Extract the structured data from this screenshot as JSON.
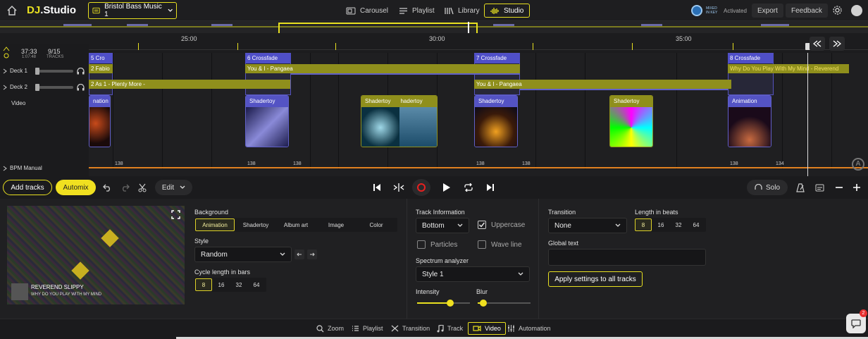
{
  "app": {
    "logo": "DJ.Studio",
    "project": "Bristol Bass Music 1"
  },
  "nav": {
    "carousel": "Carousel",
    "playlist": "Playlist",
    "library": "Library",
    "studio": "Studio"
  },
  "license": {
    "brand": "MIXED IN KEY",
    "status": "Activated"
  },
  "header": {
    "export": "Export",
    "feedback": "Feedback"
  },
  "ruler": {
    "t1": "25:00",
    "t2": "30:00",
    "t3": "35:00"
  },
  "stats": {
    "time": "37:33",
    "time_sub": "1:07:48",
    "tracks": "9/15",
    "tracks_sub": "TRACKS"
  },
  "decks": {
    "deck1": "Deck 1",
    "deck2": "Deck 2",
    "video": "Video",
    "bpm": "BPM Manual"
  },
  "transitions": {
    "t5": "5 Cro",
    "t6": "6 Crossfade",
    "t7": "7 Crossfade",
    "t8": "8 Crossfade"
  },
  "tracks": {
    "a1": "2 Fabio",
    "a2": "You & I - Pangaea",
    "a3": "Why Do You Play With My Mind - Reverend",
    "b1": "2 As 1 - Plenty More -",
    "b2": "You & I - Pangaea"
  },
  "videos": {
    "v1": "nation",
    "v2": "Shadertoy",
    "v3": "Shadertoy",
    "v3b": "hadertoy",
    "v4": "Shadertoy",
    "v5": "Shadertoy",
    "v6": "Animation"
  },
  "bpm_vals": [
    "138",
    "138",
    "138",
    "138",
    "138",
    "138",
    "134"
  ],
  "controls": {
    "add_tracks": "Add tracks",
    "automix": "Automix",
    "edit": "Edit",
    "solo": "Solo"
  },
  "preview": {
    "artist": "REVEREND SLIPPY",
    "title": "WHY DO YOU PLAY WITH MY MIND"
  },
  "background": {
    "label": "Background",
    "options": [
      "Animation",
      "Shadertoy",
      "Album art",
      "Image",
      "Color"
    ],
    "selected": "Animation"
  },
  "style": {
    "label": "Style",
    "value": "Random"
  },
  "cycle": {
    "label": "Cycle length in bars",
    "options": [
      "8",
      "16",
      "32",
      "64"
    ],
    "selected": "8"
  },
  "trackinfo": {
    "label": "Track Information",
    "value": "Bottom",
    "uppercase": "Uppercase",
    "particles": "Particles",
    "waveline": "Wave line"
  },
  "spectrum": {
    "label": "Spectrum analyzer",
    "value": "Style 1"
  },
  "intensity": {
    "label": "Intensity",
    "value": 0.62
  },
  "blur": {
    "label": "Blur",
    "value": 0.1
  },
  "transition": {
    "label": "Transition",
    "value": "None"
  },
  "length": {
    "label": "Length in beats",
    "options": [
      "8",
      "16",
      "32",
      "64"
    ],
    "selected": "8"
  },
  "global": {
    "label": "Global text",
    "placeholder": ""
  },
  "apply": "Apply settings to all tracks",
  "bottomtabs": {
    "zoom": "Zoom",
    "playlist": "Playlist",
    "transition": "Transition",
    "track": "Track",
    "video": "Video",
    "automation": "Automation"
  },
  "chat": {
    "badge": "2"
  },
  "colors": {
    "accent": "#e8e020",
    "purple": "#5453c4",
    "olive": "#8f8f1c"
  }
}
